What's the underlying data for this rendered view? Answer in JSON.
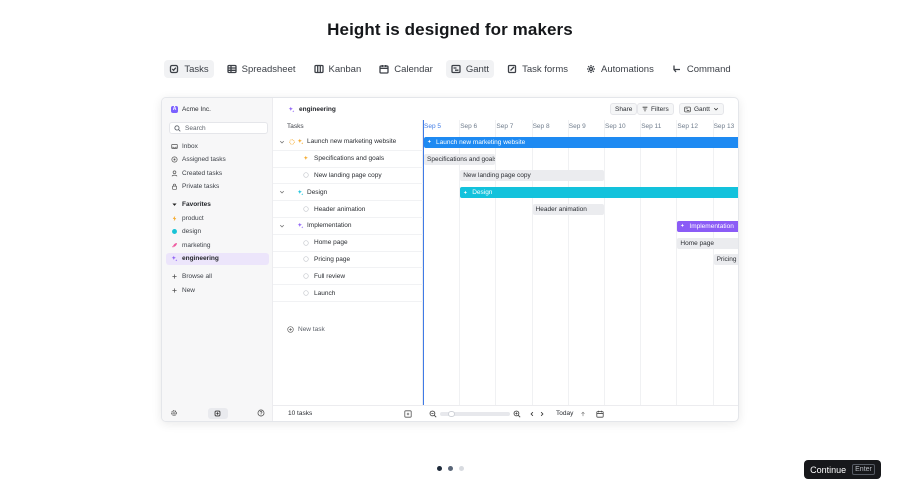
{
  "headline": "Height is designed for makers",
  "view_tabs": [
    {
      "label": "Tasks",
      "icon": "checkbox-icon",
      "active": true
    },
    {
      "label": "Spreadsheet",
      "icon": "spreadsheet-icon"
    },
    {
      "label": "Kanban",
      "icon": "kanban-icon"
    },
    {
      "label": "Calendar",
      "icon": "calendar-icon"
    },
    {
      "label": "Gantt",
      "icon": "gantt-icon",
      "active": true
    },
    {
      "label": "Task forms",
      "icon": "form-icon"
    },
    {
      "label": "Automations",
      "icon": "automation-icon"
    },
    {
      "label": "Command",
      "icon": "command-icon"
    }
  ],
  "app": {
    "workspace": {
      "logo": "A",
      "name": "Acme Inc."
    },
    "sidebar": {
      "search_label": "Search",
      "nav": [
        "Inbox",
        "Assigned tasks",
        "Created tasks",
        "Private tasks"
      ],
      "favorites_label": "Favorites",
      "favorites": [
        "product",
        "design",
        "marketing",
        "engineering"
      ],
      "browse_all": "Browse all",
      "new": "New"
    },
    "topbar": {
      "list_name": "engineering",
      "share": "Share",
      "filters": "Filters",
      "view": "Gantt"
    },
    "list": {
      "header": "Tasks",
      "rows": [
        {
          "label": "Launch new marketing website",
          "level": 0,
          "expandable": true
        },
        {
          "label": "Specifications and goals",
          "level": 1
        },
        {
          "label": "New landing page copy",
          "level": 1
        },
        {
          "label": "Design",
          "level": 0,
          "expandable": true
        },
        {
          "label": "Header animation",
          "level": 1
        },
        {
          "label": "Implementation",
          "level": 0,
          "expandable": true
        },
        {
          "label": "Home page",
          "level": 1
        },
        {
          "label": "Pricing page",
          "level": 1
        },
        {
          "label": "Full review",
          "level": 1
        },
        {
          "label": "Launch",
          "level": 1
        }
      ],
      "new_task": "New task"
    },
    "gantt": {
      "dates": [
        "Sep 5",
        "Sep 6",
        "Sep 7",
        "Sep 8",
        "Sep 9",
        "Sep 10",
        "Sep 11",
        "Sep 12",
        "Sep 13"
      ],
      "today_index": 0,
      "bars": [
        {
          "label": "Launch new marketing website",
          "start": "Sep 5",
          "end": "Sep 13",
          "color": "#1e8af2",
          "style": "blue",
          "row": 0
        },
        {
          "label": "Specifications and goals",
          "start": "Sep 5",
          "end": "Sep 6",
          "style": "gray",
          "row": 1
        },
        {
          "label": "New landing page copy",
          "start": "Sep 6",
          "end": "Sep 9",
          "style": "gray",
          "row": 2
        },
        {
          "label": "Design",
          "start": "Sep 6",
          "end": "Sep 13",
          "color": "#13c2dc",
          "style": "cyan",
          "row": 3
        },
        {
          "label": "Header animation",
          "start": "Sep 8",
          "end": "Sep 9",
          "style": "gray",
          "row": 4
        },
        {
          "label": "Implementation",
          "start": "Sep 12",
          "end": "Sep 13",
          "color": "#8b5cf6",
          "style": "purple",
          "row": 5
        },
        {
          "label": "Home page",
          "start": "Sep 12",
          "end": "Sep 13",
          "style": "gray",
          "row": 6
        },
        {
          "label": "Pricing page",
          "start": "Sep 13",
          "end": "Sep 13",
          "style": "gray",
          "row": 7
        }
      ]
    },
    "footer": {
      "task_count": "10 tasks",
      "today": "Today"
    }
  },
  "pagination": {
    "count": 3,
    "active": 1
  },
  "continue": {
    "label": "Continue",
    "shortcut": "Enter"
  }
}
